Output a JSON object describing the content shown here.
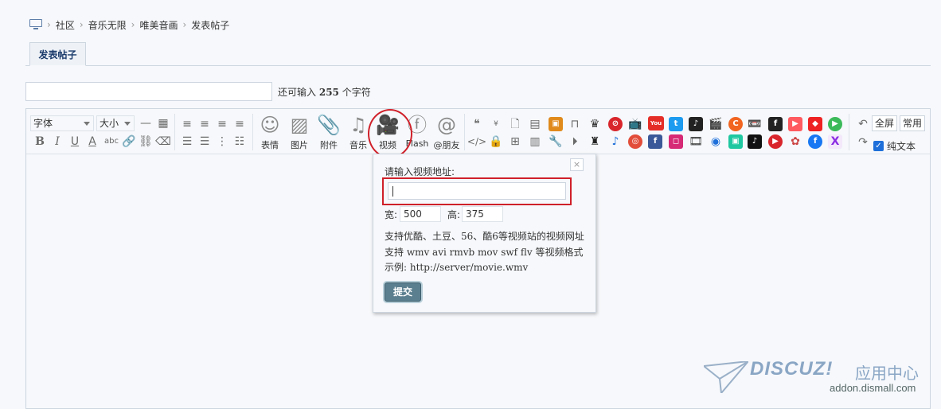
{
  "breadcrumb": {
    "items": [
      "社区",
      "音乐无限",
      "唯美音画",
      "发表帖子"
    ]
  },
  "tab": {
    "label": "发表帖子"
  },
  "subject": {
    "hint_prefix": "还可输入",
    "remaining": "255",
    "hint_suffix": "个字符"
  },
  "toolbar": {
    "font_select": "字体",
    "size_select": "大小",
    "big_buttons": [
      "表情",
      "图片",
      "附件",
      "音乐",
      "视频",
      "Flash",
      "@朋友"
    ],
    "fullscreen": "全屏",
    "common": "常用",
    "plain_text": "纯文本"
  },
  "video_popup": {
    "label": "请输入视频地址:",
    "width_label": "宽:",
    "width_value": "500",
    "height_label": "高:",
    "height_value": "375",
    "info_line1": "支持优酷、土豆、56、酷6等视频站的视频网址",
    "info_line2": "支持 wmv avi rmvb mov swf flv 等视频格式",
    "info_line3": "示例: http://server/movie.wmv",
    "submit": "提交",
    "close": "×"
  },
  "watermark": {
    "brand": "DISCUZ!",
    "brand_cn": "应用中心",
    "domain": "addon.dismall.com"
  },
  "colors": {
    "annotation_red": "#d0202a",
    "submit_bg": "#5b7f8f",
    "checkbox_blue": "#1e6fd9"
  }
}
